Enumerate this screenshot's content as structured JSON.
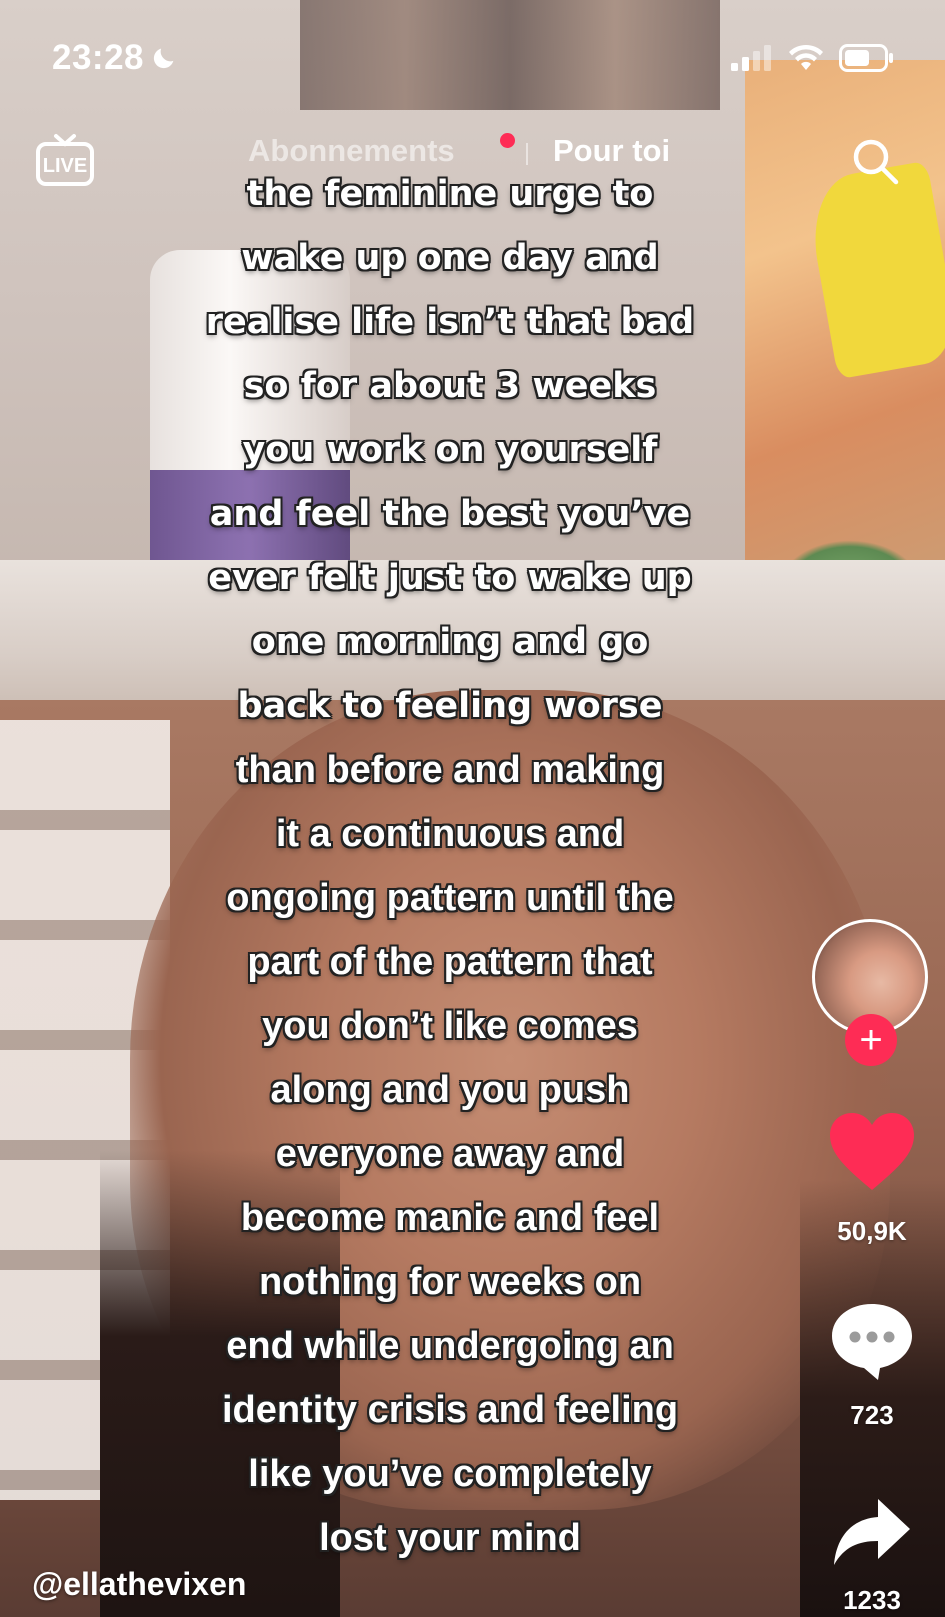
{
  "status_bar": {
    "time": "23:28",
    "icons": [
      "moon-icon",
      "signal-icon",
      "wifi-icon",
      "battery-icon"
    ]
  },
  "nav": {
    "live_label": "LIVE",
    "tabs": [
      {
        "label": "Abonnements",
        "active": false,
        "has_dot": true
      },
      {
        "label": "Pour toi",
        "active": true
      }
    ],
    "search_icon": "search-icon"
  },
  "caption": {
    "lines": [
      "the feminine urge to",
      "wake up one day and",
      "realise life isn’t that bad",
      "so for about 3 weeks",
      "you work on yourself",
      "and feel the best you’ve",
      "ever felt just to wake up",
      "one morning and go",
      "back to feeling worse",
      "than before and making",
      "it a continuous and",
      "ongoing pattern until the",
      "part of the pattern that",
      "you don’t like comes",
      "along and you push",
      "everyone away and",
      "become manic and feel",
      "nothing for weeks on",
      "end while undergoing an",
      "identity crisis and feeling",
      "like you’ve completely",
      "lost your mind"
    ]
  },
  "rail": {
    "follow_label": "+",
    "likes": "50,9K",
    "comments": "723",
    "shares": "1233"
  },
  "author": {
    "username": "@ellathevixen"
  },
  "colors": {
    "accent": "#fe2c55",
    "text": "#ffffff"
  }
}
